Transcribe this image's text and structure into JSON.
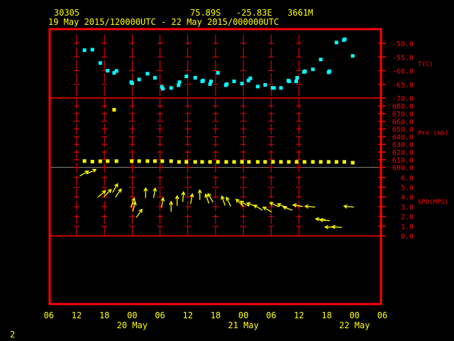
{
  "header": {
    "station": "30305",
    "location": "75.89S   -25.83E   3661M",
    "time_range": "19 May 2015/120000UTC - 22 May 2015/000000UTC"
  },
  "footer": {
    "frame_number": "2"
  },
  "colors": {
    "frame": "#ff0000",
    "temperature": "#00ffff",
    "pressure": "#ffff00",
    "wind": "#ffff00",
    "text": "#ffff00",
    "separator": "#808080"
  },
  "chart_data": [
    {
      "type": "scatter",
      "title": "T(C)",
      "ylabel": "T(C)",
      "ylim": [
        -70,
        -50
      ],
      "yticks": [
        "-50.0",
        "-55.0",
        "-60.0",
        "-65.0",
        "-70.0"
      ],
      "ytick_values": [
        -50,
        -55,
        -60,
        -65,
        -70
      ],
      "x_units": "hours since 19 May 2015 12Z",
      "points": [
        [
          1.7,
          -52.5
        ],
        [
          3.4,
          -52.3
        ],
        [
          5.1,
          -57.2
        ],
        [
          6.7,
          -60.0
        ],
        [
          8.1,
          -60.8
        ],
        [
          8.6,
          -60.1
        ],
        [
          11.8,
          -64.2
        ],
        [
          12.0,
          -64.6
        ],
        [
          13.5,
          -63.2
        ],
        [
          15.3,
          -61.1
        ],
        [
          16.9,
          -62.6
        ],
        [
          18.4,
          -65.9
        ],
        [
          18.6,
          -66.6
        ],
        [
          20.4,
          -66.3
        ],
        [
          22.0,
          -65.3
        ],
        [
          22.2,
          -64.2
        ],
        [
          23.7,
          -62.1
        ],
        [
          25.6,
          -62.6
        ],
        [
          27.1,
          -63.9
        ],
        [
          27.3,
          -63.6
        ],
        [
          28.8,
          -64.9
        ],
        [
          29.0,
          -63.9
        ],
        [
          30.5,
          -60.8
        ],
        [
          32.2,
          -65.3
        ],
        [
          32.4,
          -64.9
        ],
        [
          34.0,
          -63.9
        ],
        [
          35.7,
          -64.7
        ],
        [
          37.1,
          -63.6
        ],
        [
          37.5,
          -62.8
        ],
        [
          39.1,
          -65.8
        ],
        [
          40.7,
          -65.2
        ],
        [
          42.3,
          -66.3
        ],
        [
          42.6,
          -66.3
        ],
        [
          44.1,
          -66.3
        ],
        [
          45.7,
          -63.6
        ],
        [
          45.9,
          -63.9
        ],
        [
          47.4,
          -63.9
        ],
        [
          47.6,
          -62.6
        ],
        [
          49.1,
          -60.5
        ],
        [
          49.3,
          -60.2
        ],
        [
          51.0,
          -59.5
        ],
        [
          52.7,
          -55.9
        ],
        [
          54.4,
          -60.6
        ],
        [
          54.6,
          -60.2
        ],
        [
          56.1,
          -49.7
        ],
        [
          57.7,
          -48.8
        ],
        [
          57.9,
          -48.5
        ],
        [
          59.6,
          -54.6
        ]
      ]
    },
    {
      "type": "scatter",
      "title": "Pre (mb)",
      "ylabel": "Pre (mb)",
      "ylim": [
        600,
        680
      ],
      "yticks": [
        "680.0",
        "670.0",
        "660.0",
        "650.0",
        "640.0",
        "630.0",
        "620.0",
        "610.0",
        "600.0"
      ],
      "ytick_values": [
        680,
        670,
        660,
        650,
        640,
        630,
        620,
        610,
        600
      ],
      "points": [
        [
          1.7,
          608.3
        ],
        [
          3.4,
          607.6
        ],
        [
          5.1,
          608.0
        ],
        [
          6.7,
          608.2
        ],
        [
          8.6,
          608.2
        ],
        [
          8.1,
          675.0
        ],
        [
          11.9,
          608.2
        ],
        [
          13.5,
          608.2
        ],
        [
          15.3,
          608.2
        ],
        [
          16.9,
          608.2
        ],
        [
          18.5,
          608.2
        ],
        [
          20.4,
          608.2
        ],
        [
          22.1,
          607.2
        ],
        [
          23.7,
          607.2
        ],
        [
          25.6,
          607.2
        ],
        [
          27.1,
          607.2
        ],
        [
          28.8,
          607.2
        ],
        [
          30.5,
          607.2
        ],
        [
          32.3,
          607.2
        ],
        [
          34.0,
          607.2
        ],
        [
          35.7,
          607.2
        ],
        [
          37.2,
          607.2
        ],
        [
          39.1,
          607.2
        ],
        [
          40.7,
          607.2
        ],
        [
          42.4,
          607.2
        ],
        [
          44.1,
          607.2
        ],
        [
          45.8,
          607.2
        ],
        [
          47.5,
          607.2
        ],
        [
          49.2,
          607.2
        ],
        [
          51.0,
          607.2
        ],
        [
          52.7,
          607.2
        ],
        [
          54.4,
          607.2
        ],
        [
          56.1,
          607.2
        ],
        [
          57.8,
          607.2
        ],
        [
          59.6,
          606.2
        ]
      ]
    },
    {
      "type": "vector",
      "title": "SPD(MPS)",
      "ylabel": "SPD(MPS)",
      "ylim": [
        0,
        6
      ],
      "yticks": [
        "6.0",
        "5.0",
        "4.0",
        "3.0",
        "2.0",
        "1.0",
        "0.0"
      ],
      "ytick_values": [
        6,
        5,
        4,
        3,
        2,
        1,
        0
      ],
      "vector_fields": [
        "hour",
        "speed_mps",
        "heading_deg"
      ],
      "vectors": [
        [
          1.6,
          6.4,
          60
        ],
        [
          3.2,
          6.6,
          65
        ],
        [
          5.4,
          4.3,
          50
        ],
        [
          6.7,
          4.4,
          45
        ],
        [
          8.3,
          4.9,
          30
        ],
        [
          9.0,
          4.4,
          35
        ],
        [
          12.1,
          3.4,
          20
        ],
        [
          12.4,
          3.0,
          15
        ],
        [
          13.5,
          2.3,
          35
        ],
        [
          14.9,
          4.4,
          0
        ],
        [
          16.8,
          4.4,
          10
        ],
        [
          18.5,
          3.4,
          10
        ],
        [
          20.4,
          3.0,
          0
        ],
        [
          21.7,
          3.6,
          0
        ],
        [
          23.0,
          4.0,
          5
        ],
        [
          24.8,
          3.8,
          10
        ],
        [
          26.6,
          4.2,
          0
        ],
        [
          28.2,
          3.8,
          -20
        ],
        [
          28.9,
          3.9,
          -30
        ],
        [
          31.7,
          3.6,
          -20
        ],
        [
          32.8,
          3.5,
          -25
        ],
        [
          35.2,
          3.4,
          -45
        ],
        [
          36.3,
          3.3,
          -60
        ],
        [
          37.8,
          3.2,
          -70
        ],
        [
          39.2,
          2.9,
          -60
        ],
        [
          41.2,
          2.7,
          -60
        ],
        [
          42.7,
          3.2,
          -65
        ],
        [
          44.4,
          3.1,
          -70
        ],
        [
          45.6,
          2.8,
          -70
        ],
        [
          47.8,
          3.1,
          -80
        ],
        [
          50.4,
          3.0,
          -85
        ],
        [
          52.7,
          1.7,
          -85
        ],
        [
          53.6,
          1.6,
          -85
        ],
        [
          54.7,
          0.9,
          -90
        ],
        [
          56.2,
          0.9,
          -85
        ],
        [
          58.8,
          3.0,
          -85
        ]
      ]
    }
  ],
  "x_axis": {
    "hour_labels": [
      "06",
      "12",
      "18",
      "00",
      "06",
      "12",
      "18",
      "00",
      "06",
      "12",
      "18",
      "00",
      "06"
    ],
    "date_labels": [
      "20 May",
      "21 May",
      "22 May"
    ]
  }
}
